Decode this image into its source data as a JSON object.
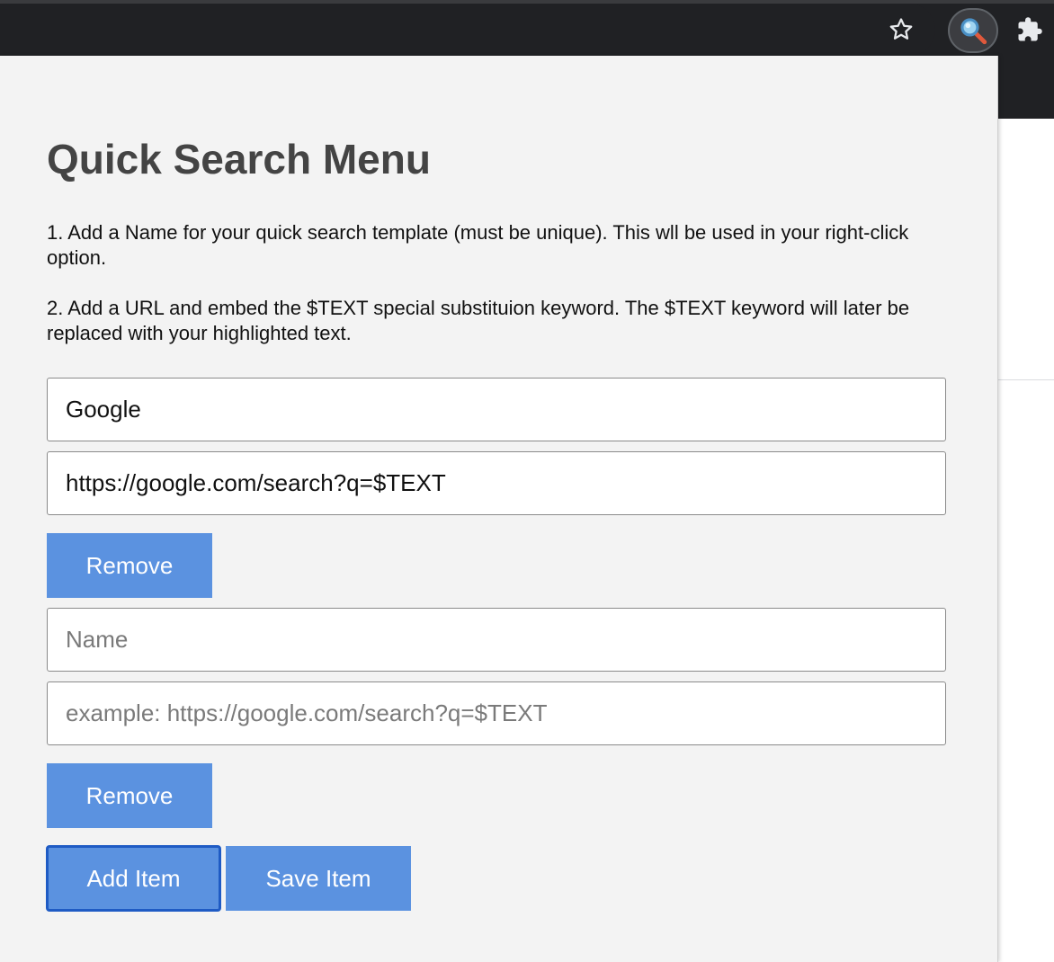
{
  "browser": {
    "star_icon": "star-outline-icon",
    "extension_icon": "magnifier-icon",
    "puzzle_icon": "puzzle-piece-icon"
  },
  "popup": {
    "title": "Quick Search Menu",
    "instructions": [
      "1. Add a Name for your quick search template (must be unique). This wll be used in your right-click option.",
      "2. Add a URL and embed the $TEXT special substituion keyword. The $TEXT keyword will later be replaced with your highlighted text."
    ],
    "items": [
      {
        "name_value": "Google",
        "name_placeholder": "Name",
        "url_value": "https://google.com/search?q=$TEXT",
        "url_placeholder": "example: https://google.com/search?q=$TEXT",
        "remove_label": "Remove"
      },
      {
        "name_value": "",
        "name_placeholder": "Name",
        "url_value": "",
        "url_placeholder": "example: https://google.com/search?q=$TEXT",
        "remove_label": "Remove"
      }
    ],
    "add_label": "Add Item",
    "save_label": "Save Item"
  },
  "colors": {
    "button_bg": "#5b92e0",
    "button_text": "#ffffff",
    "popup_bg": "#f3f3f3",
    "focus_border": "#1f5bc4",
    "toolbar_bg": "#202124"
  }
}
